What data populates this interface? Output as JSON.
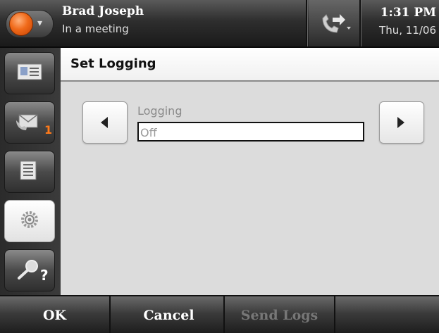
{
  "header": {
    "user_name": "Brad Joseph",
    "user_status": "In a meeting",
    "time": "1:31 PM",
    "date": "Thu, 11/06",
    "presence_color": "#f06a1a"
  },
  "nav": {
    "items": [
      {
        "icon": "contact-card-icon"
      },
      {
        "icon": "voicemail-icon",
        "badge": "1"
      },
      {
        "icon": "call-log-icon"
      },
      {
        "icon": "settings-gear-icon",
        "active": true
      },
      {
        "icon": "help-search-icon",
        "extra": "?"
      }
    ]
  },
  "page": {
    "title": "Set Logging",
    "field_label": "Logging",
    "field_value": "Off"
  },
  "softkeys": {
    "ok": "OK",
    "cancel": "Cancel",
    "send_logs": "Send Logs"
  }
}
